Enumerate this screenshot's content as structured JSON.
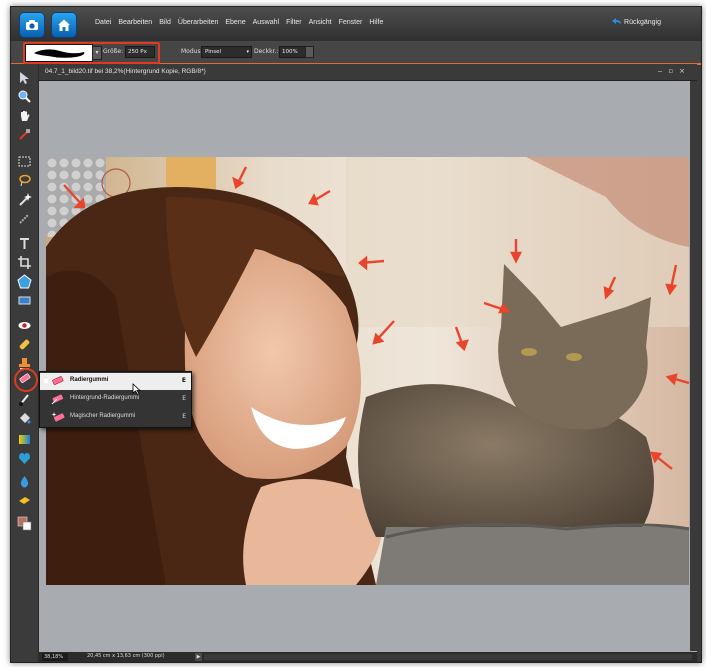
{
  "menubar": {
    "items": [
      "Datei",
      "Bearbeiten",
      "Bild",
      "Überarbeiten",
      "Ebene",
      "Auswahl",
      "Filter",
      "Ansicht",
      "Fenster",
      "Hilfe"
    ],
    "undo_label": "Rückgängig"
  },
  "options": {
    "size_label": "Größe:",
    "size_value": "250 Px",
    "mode_label": "Modus:",
    "mode_value": "Pinsel",
    "opacity_label": "Deckkr.:",
    "opacity_value": "100%"
  },
  "document": {
    "title": "04.7_1_bild20.tif bei 38,2%(Hintergrund Kopie, RGB/8*)",
    "zoom": "38,18%",
    "dimensions": "20,45 cm x 13,63 cm (300 ppi)"
  },
  "flyout": {
    "items": [
      {
        "label": "Radiergummi",
        "key": "E"
      },
      {
        "label": "Hintergrund-Radiergummi",
        "key": "E"
      },
      {
        "label": "Magischer Radiergummi",
        "key": "E"
      }
    ]
  },
  "colors": {
    "accent": "#e8692d",
    "highlight": "#e03a20",
    "arrow": "#e8452c"
  },
  "icons": {
    "app_logo": "camera-logo-icon",
    "home": "home-icon",
    "undo": "undo-icon"
  }
}
